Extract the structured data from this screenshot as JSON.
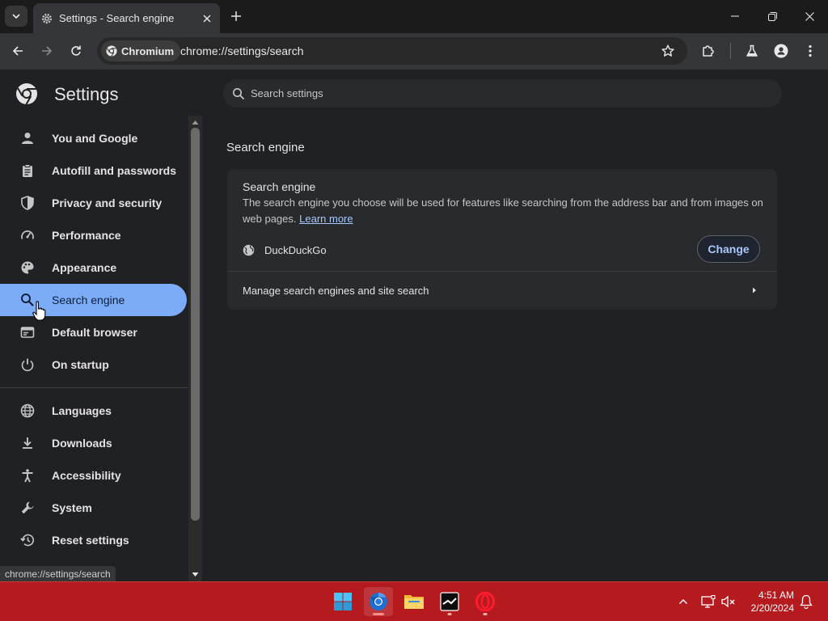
{
  "tab": {
    "title": "Settings - Search engine"
  },
  "toolbar": {
    "chip_label": "Chromium",
    "url": "chrome://settings/search"
  },
  "settings": {
    "title": "Settings",
    "search_placeholder": "Search settings"
  },
  "sidebar": {
    "items": [
      {
        "label": "You and Google",
        "icon": "person-icon"
      },
      {
        "label": "Autofill and passwords",
        "icon": "clipboard-icon"
      },
      {
        "label": "Privacy and security",
        "icon": "shield-icon"
      },
      {
        "label": "Performance",
        "icon": "speedometer-icon"
      },
      {
        "label": "Appearance",
        "icon": "palette-icon"
      },
      {
        "label": "Search engine",
        "icon": "search-icon",
        "active": true
      },
      {
        "label": "Default browser",
        "icon": "browser-window-icon"
      },
      {
        "label": "On startup",
        "icon": "power-icon"
      },
      {
        "label": "Languages",
        "icon": "globe-icon"
      },
      {
        "label": "Downloads",
        "icon": "download-icon"
      },
      {
        "label": "Accessibility",
        "icon": "accessibility-icon"
      },
      {
        "label": "System",
        "icon": "wrench-icon"
      },
      {
        "label": "Reset settings",
        "icon": "history-icon"
      }
    ]
  },
  "status_bubble": "chrome://settings/search",
  "main": {
    "section_title": "Search engine",
    "card": {
      "heading": "Search engine",
      "description": "The search engine you choose will be used for features like searching from the address bar and from images on web pages.",
      "learn_more": "Learn more",
      "engine_name": "DuckDuckGo",
      "change_label": "Change",
      "manage_label": "Manage search engines and site search"
    }
  },
  "taskbar": {
    "apps": [
      "start-button",
      "chromium-app",
      "file-explorer-app",
      "steam-app",
      "opera-app"
    ],
    "time": "4:51 AM",
    "date": "2/20/2024"
  },
  "colors": {
    "accent": "#7cacf8",
    "link": "#a8c7fa",
    "taskbar": "#b51a1f"
  }
}
